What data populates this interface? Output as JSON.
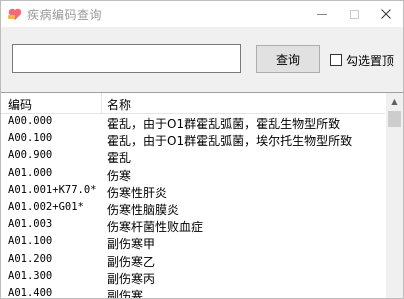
{
  "window": {
    "title": "疾病编码查询"
  },
  "search": {
    "value": "",
    "button_label": "查询"
  },
  "pin_top": {
    "label": "勾选置顶",
    "checked": false
  },
  "table": {
    "columns": [
      "编码",
      "名称"
    ],
    "rows": [
      {
        "code": "A00.000",
        "name": "霍乱，由于O1群霍乱弧菌，霍乱生物型所致"
      },
      {
        "code": "A00.100",
        "name": "霍乱，由于O1群霍乱弧菌，埃尔托生物型所致"
      },
      {
        "code": "A00.900",
        "name": "霍乱"
      },
      {
        "code": "A01.000",
        "name": "伤寒"
      },
      {
        "code": "A01.001+K77.0*",
        "name": "伤寒性肝炎"
      },
      {
        "code": "A01.002+G01*",
        "name": "伤寒性脑膜炎"
      },
      {
        "code": "A01.003",
        "name": "伤寒杆菌性败血症"
      },
      {
        "code": "A01.100",
        "name": "副伤寒甲"
      },
      {
        "code": "A01.200",
        "name": "副伤寒乙"
      },
      {
        "code": "A01.300",
        "name": "副伤寒丙"
      },
      {
        "code": "A01.400",
        "name": "副伤寒"
      }
    ]
  }
}
